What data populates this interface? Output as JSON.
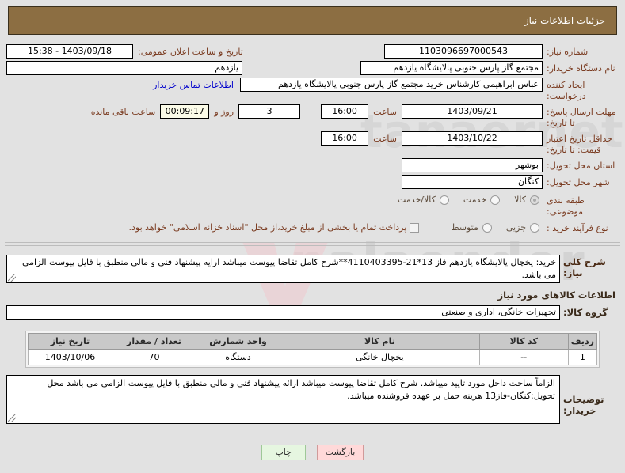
{
  "header": {
    "title": "جزئیات اطلاعات نیاز",
    "bar_color": "#8c6e42"
  },
  "form": {
    "need_number": {
      "label": "شماره نیاز:",
      "value": "1103096697000543"
    },
    "announce_datetime": {
      "label": "تاریخ و ساعت اعلان عمومی:",
      "value": "1403/09/18 - 15:38"
    },
    "buyer_org": {
      "label": "نام دستگاه خریدار:",
      "value": "مجتمع گاز پارس جنوبی  پالایشگاه یازدهم",
      "value_overflow": "یازدهم"
    },
    "requester": {
      "label": "ایجاد کننده درخواست:",
      "value": "عباس ابراهیمی کارشناس خرید مجتمع گاز پارس جنوبی  پالایشگاه یازدهم"
    },
    "buyer_contact_link": "اطلاعات تماس خریدار",
    "response_deadline": {
      "label": "مهلت ارسال پاسخ: تا تاریخ:",
      "date": "1403/09/21",
      "time_label": "ساعت",
      "time": "16:00",
      "days_value": "3",
      "days_label": "روز و",
      "countdown": "00:09:17",
      "countdown_label": "ساعت باقی مانده"
    },
    "price_validity": {
      "label": "حداقل تاریخ اعتبار قیمت: تا تاریخ:",
      "date": "1403/10/22",
      "time_label": "ساعت",
      "time": "16:00"
    },
    "delivery_province": {
      "label": "استان محل تحویل:",
      "value": "بوشهر"
    },
    "delivery_city": {
      "label": "شهر محل تحویل:",
      "value": "کنگان"
    },
    "subject_category": {
      "label": "طبقه بندی موضوعی:",
      "options": [
        "کالا",
        "خدمت",
        "کالا/خدمت"
      ],
      "selected": "کالا"
    },
    "purchase_process": {
      "label": "نوع فرآیند خرید :",
      "options": [
        "جزیی",
        "متوسط"
      ],
      "selected": "",
      "checkbox_text": "پرداخت تمام یا بخشی از مبلغ خرید،از محل \"اسناد خزانه اسلامی\" خواهد بود.",
      "checkbox_checked": false
    }
  },
  "description": {
    "label": "شرح کلی نیاز:",
    "value": "خرید: یخچال پالایشگاه یازدهم فاز 13*21-4110403395**شرح کامل تقاضا پیوست میباشد ارایه پیشنهاد فنی و مالی منطبق با فایل پیوست الزامی می باشد."
  },
  "goods_section": {
    "title": "اطلاعات کالاهای مورد نیاز",
    "group": {
      "label": "گروه کالا:",
      "value": "تجهیزات خانگی، اداری و صنعتی"
    },
    "table": {
      "columns": [
        "ردیف",
        "کد کالا",
        "نام کالا",
        "واحد شمارش",
        "تعداد / مقدار",
        "تاریخ نیاز"
      ],
      "rows": [
        {
          "row_no": "1",
          "code": "--",
          "name": "یخچال خانگی",
          "unit": "دستگاه",
          "quantity": "70",
          "need_date": "1403/10/06"
        }
      ]
    }
  },
  "buyer_notes": {
    "label": "توضیحات خریدار:",
    "value": "الزاماً ساخت داخل مورد تایید میباشد. شرح کامل تقاضا پیوست میباشد ارائه پیشنهاد فنی و مالی منطبق با فایل پیوست الزامی می باشد محل تحویل:کنگان-فاز13 هزینه حمل بر عهده فروشنده میباشد."
  },
  "buttons": {
    "back": "بازگشت",
    "print": "چاپ"
  },
  "watermark": {
    "text_1": "nalaender",
    "text_2": "tanaernet"
  }
}
